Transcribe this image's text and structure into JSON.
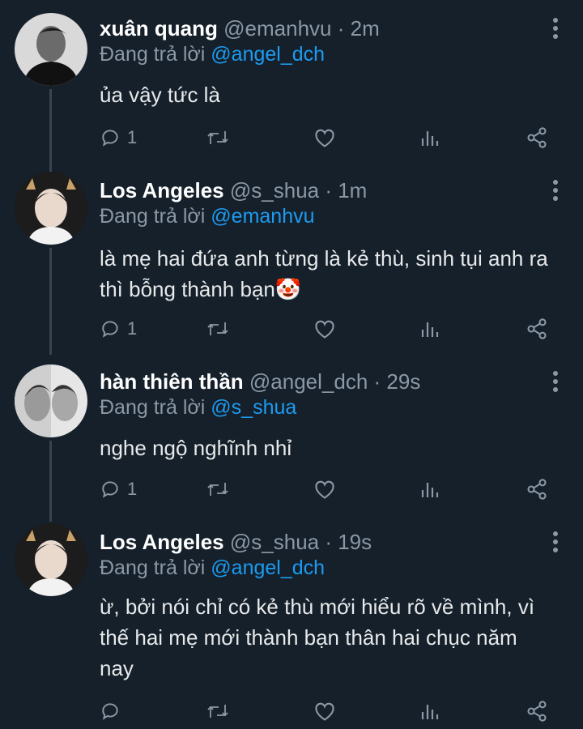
{
  "tweets": [
    {
      "name": "xuân quang",
      "handle": "@emanhvu",
      "time": "· 2m",
      "reply_prefix": "Đang trả lời ",
      "reply_to": "@angel_dch",
      "text_lines": [
        "ủa vậy tức là"
      ],
      "reply_count": "1"
    },
    {
      "name": "Los Angeles",
      "handle": "@s_shua",
      "time": "· 1m",
      "reply_prefix": "Đang trả lời ",
      "reply_to": "@emanhvu",
      "text_lines": [
        "là mẹ hai đứa anh từng là kẻ thù, sinh tụi anh ra",
        "thì bỗng thành bạn🤡"
      ],
      "reply_count": "1"
    },
    {
      "name": "hàn thiên thần",
      "handle": "@angel_dch",
      "time": "· 29s",
      "reply_prefix": "Đang trả lời ",
      "reply_to": "@s_shua",
      "text_lines": [
        "nghe ngộ nghĩnh nhỉ"
      ],
      "reply_count": "1"
    },
    {
      "name": "Los Angeles",
      "handle": "@s_shua",
      "time": "· 19s",
      "reply_prefix": "Đang trả lời ",
      "reply_to": "@angel_dch",
      "text_lines": [
        "ừ, bởi nói chỉ có kẻ thù mới hiểu rõ về mình, vì",
        "thế hai mẹ mới thành bạn thân hai chục năm",
        "nay"
      ],
      "reply_count": ""
    }
  ],
  "colors": {
    "background": "#15202b",
    "secondary_text": "#8b98a5",
    "mention": "#1d9bf0",
    "thread_line": "#38444d"
  },
  "icons": [
    "reply-icon",
    "retweet-icon",
    "like-icon",
    "analytics-icon",
    "share-icon",
    "more-icon"
  ]
}
